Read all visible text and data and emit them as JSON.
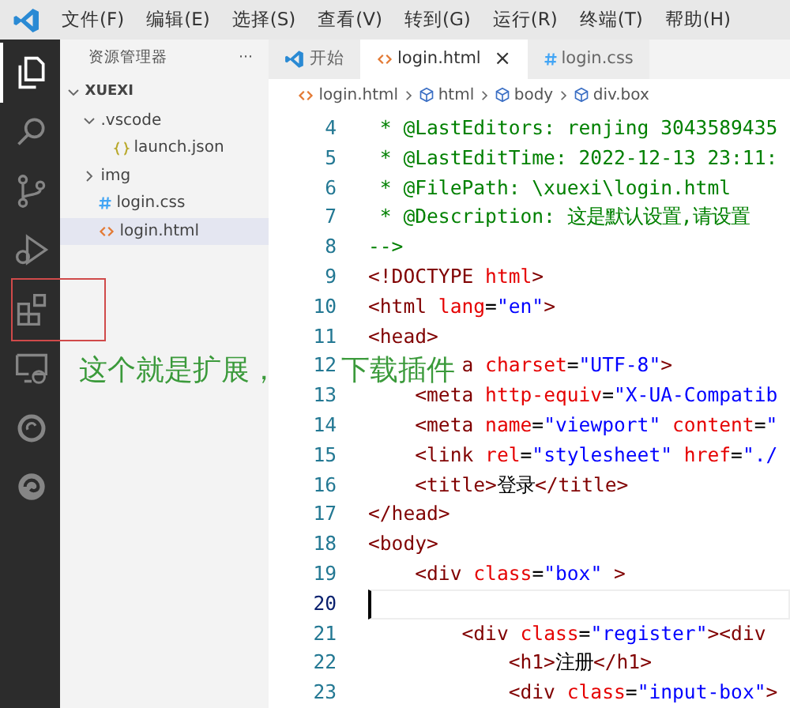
{
  "menu_bar": {
    "items": [
      "文件(F)",
      "编辑(E)",
      "选择(S)",
      "查看(V)",
      "转到(G)",
      "运行(R)",
      "终端(T)",
      "帮助(H)"
    ]
  },
  "activity_bar": [
    {
      "kind": "files",
      "selected": true
    },
    {
      "kind": "search",
      "selected": false
    },
    {
      "kind": "source-control",
      "selected": false
    },
    {
      "kind": "run-debug",
      "selected": false
    },
    {
      "kind": "extensions",
      "selected": false,
      "highlighted": true
    },
    {
      "kind": "remote",
      "selected": false
    },
    {
      "kind": "ring",
      "selected": false
    },
    {
      "kind": "swirl",
      "selected": false
    }
  ],
  "sidebar": {
    "title": "资源管理器",
    "more": "···",
    "tree": [
      {
        "label": "XUEXI",
        "kind": "root",
        "expanded": true,
        "selected": false,
        "children": [
          {
            "label": ".vscode",
            "kind": "folder",
            "expanded": true,
            "selected": false,
            "children": [
              {
                "label": "launch.json",
                "kind": "json",
                "selected": false
              }
            ]
          },
          {
            "label": "img",
            "kind": "folder",
            "expanded": false,
            "selected": false
          },
          {
            "label": "login.css",
            "kind": "css",
            "selected": false
          },
          {
            "label": "login.html",
            "kind": "html",
            "selected": true
          }
        ]
      }
    ]
  },
  "tabs": [
    {
      "label": "开始",
      "kind": "welcome",
      "selected": false
    },
    {
      "label": "login.html",
      "kind": "html",
      "selected": true,
      "close": "×"
    },
    {
      "label": "login.css",
      "kind": "css",
      "selected": false
    }
  ],
  "breadcrumb": [
    {
      "label": "login.html",
      "kind": "file"
    },
    {
      "label": "html",
      "kind": "element"
    },
    {
      "label": "body",
      "kind": "element"
    },
    {
      "label": "div.box",
      "kind": "element"
    }
  ],
  "code_lines": [
    {
      "number": "4",
      "current": false,
      "tokens": [
        {
          "kind": "comment",
          "text": " * @LastEditors: renjing 3043589435"
        }
      ]
    },
    {
      "number": "5",
      "current": false,
      "tokens": [
        {
          "kind": "comment",
          "text": " * @LastEditTime: 2022-12-13 23:11:"
        }
      ]
    },
    {
      "number": "6",
      "current": false,
      "tokens": [
        {
          "kind": "comment",
          "text": " * @FilePath: \\xuexi\\login.html"
        }
      ]
    },
    {
      "number": "7",
      "current": false,
      "tokens": [
        {
          "kind": "comment",
          "text": " * @Description: 这是默认设置,请设置"
        }
      ]
    },
    {
      "number": "8",
      "current": false,
      "tokens": [
        {
          "kind": "comment",
          "text": "-->"
        }
      ]
    },
    {
      "number": "9",
      "current": false,
      "tokens": [
        {
          "kind": "tag",
          "text": "<!DOCTYPE "
        },
        {
          "kind": "attr",
          "text": "html"
        },
        {
          "kind": "tag",
          "text": ">"
        }
      ]
    },
    {
      "number": "10",
      "current": false,
      "tokens": [
        {
          "kind": "tag",
          "text": "<html "
        },
        {
          "kind": "attr",
          "text": "lang"
        },
        {
          "kind": "plain",
          "text": "="
        },
        {
          "kind": "string",
          "text": "\"en\""
        },
        {
          "kind": "tag",
          "text": ">"
        }
      ]
    },
    {
      "number": "11",
      "current": false,
      "tokens": [
        {
          "kind": "tag",
          "text": "<head>"
        }
      ]
    },
    {
      "number": "12",
      "current": false,
      "tokens": [
        {
          "kind": "tag",
          "text": "        a "
        },
        {
          "kind": "attr",
          "text": "charset"
        },
        {
          "kind": "plain",
          "text": "="
        },
        {
          "kind": "string",
          "text": "\"UTF-8\""
        },
        {
          "kind": "tag",
          "text": ">"
        }
      ]
    },
    {
      "number": "13",
      "current": false,
      "tokens": [
        {
          "kind": "tag",
          "text": "    <meta "
        },
        {
          "kind": "attr",
          "text": "http-equiv"
        },
        {
          "kind": "plain",
          "text": "="
        },
        {
          "kind": "string",
          "text": "\"X-UA-Compatib"
        }
      ]
    },
    {
      "number": "14",
      "current": false,
      "tokens": [
        {
          "kind": "tag",
          "text": "    <meta "
        },
        {
          "kind": "attr",
          "text": "name"
        },
        {
          "kind": "plain",
          "text": "="
        },
        {
          "kind": "string",
          "text": "\"viewport\" "
        },
        {
          "kind": "attr",
          "text": "content"
        },
        {
          "kind": "plain",
          "text": "="
        },
        {
          "kind": "string",
          "text": "\""
        }
      ]
    },
    {
      "number": "15",
      "current": false,
      "tokens": [
        {
          "kind": "tag",
          "text": "    <link "
        },
        {
          "kind": "attr",
          "text": "rel"
        },
        {
          "kind": "plain",
          "text": "="
        },
        {
          "kind": "string",
          "text": "\"stylesheet\" "
        },
        {
          "kind": "attr",
          "text": "href"
        },
        {
          "kind": "plain",
          "text": "="
        },
        {
          "kind": "string",
          "text": "\"./"
        }
      ]
    },
    {
      "number": "16",
      "current": false,
      "tokens": [
        {
          "kind": "tag",
          "text": "    <title>"
        },
        {
          "kind": "plain",
          "text": "登录"
        },
        {
          "kind": "tag",
          "text": "</title>"
        }
      ]
    },
    {
      "number": "17",
      "current": false,
      "tokens": [
        {
          "kind": "tag",
          "text": "</head>"
        }
      ]
    },
    {
      "number": "18",
      "current": false,
      "tokens": [
        {
          "kind": "tag",
          "text": "<body>"
        }
      ]
    },
    {
      "number": "19",
      "current": false,
      "tokens": [
        {
          "kind": "tag",
          "text": "    <div "
        },
        {
          "kind": "attr",
          "text": "class"
        },
        {
          "kind": "plain",
          "text": "="
        },
        {
          "kind": "string",
          "text": "\"box\" "
        },
        {
          "kind": "tag",
          "text": ">"
        }
      ]
    },
    {
      "number": "20",
      "current": true
    },
    {
      "number": "21",
      "current": false,
      "tokens": [
        {
          "kind": "tag",
          "text": "        <div "
        },
        {
          "kind": "attr",
          "text": "class"
        },
        {
          "kind": "plain",
          "text": "="
        },
        {
          "kind": "string",
          "text": "\"register\""
        },
        {
          "kind": "tag",
          "text": "><div"
        }
      ]
    },
    {
      "number": "22",
      "current": false,
      "tokens": [
        {
          "kind": "tag",
          "text": "            <h1>"
        },
        {
          "kind": "plain",
          "text": "注册"
        },
        {
          "kind": "tag",
          "text": "</h1>"
        }
      ]
    },
    {
      "number": "23",
      "current": false,
      "tokens": [
        {
          "kind": "tag",
          "text": "            <div "
        },
        {
          "kind": "attr",
          "text": "class"
        },
        {
          "kind": "plain",
          "text": "="
        },
        {
          "kind": "string",
          "text": "\"input-box\""
        },
        {
          "kind": "tag",
          "text": ">"
        }
      ]
    }
  ],
  "annotation": {
    "parts": [
      "这个就是扩展，",
      "下载插件"
    ]
  }
}
